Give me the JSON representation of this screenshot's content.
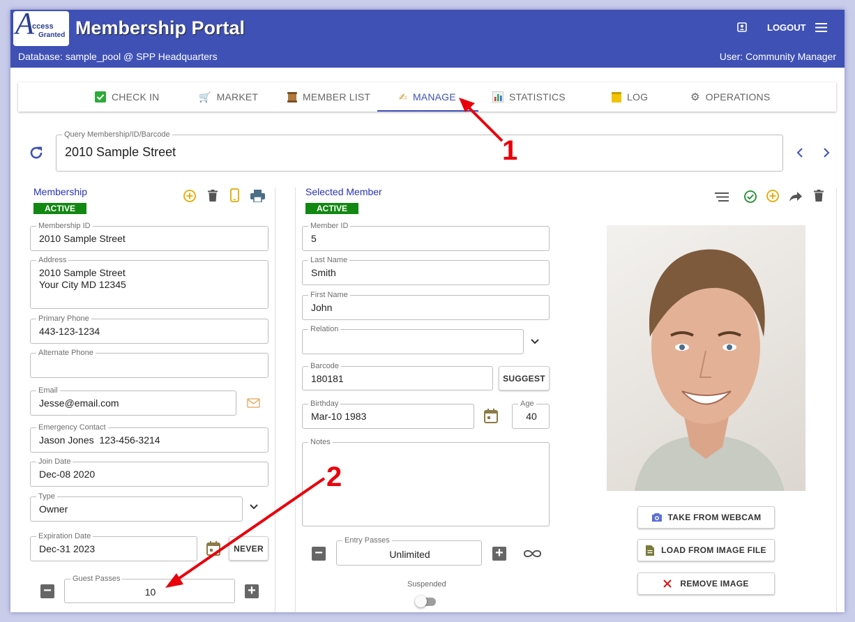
{
  "header": {
    "logo_line1": "ccess",
    "logo_line2": "Granted",
    "title": "Membership Portal",
    "database": "Database: sample_pool @ SPP Headquarters",
    "user": "User: Community Manager",
    "logout": "LOGOUT"
  },
  "tabs": [
    {
      "label": "CHECK IN",
      "icon": "check-mark-icon",
      "color": "#2eaa3a"
    },
    {
      "label": "MARKET",
      "icon": "cart-icon",
      "color": "#444"
    },
    {
      "label": "MEMBER LIST",
      "icon": "scroll-icon",
      "color": "#8b5a2b"
    },
    {
      "label": "MANAGE",
      "icon": "writing-hand-icon",
      "color": "#e0a030"
    },
    {
      "label": "STATISTICS",
      "icon": "bar-chart-icon",
      "color": "#d33"
    },
    {
      "label": "LOG",
      "icon": "notepad-icon",
      "color": "#e8c000"
    },
    {
      "label": "OPERATIONS",
      "icon": "gear-icon",
      "color": "#777"
    }
  ],
  "query": {
    "label": "Query Membership/ID/Barcode",
    "value": "2010 Sample Street"
  },
  "membership": {
    "title": "Membership",
    "status": "ACTIVE",
    "membership_id": {
      "label": "Membership ID",
      "value": "2010 Sample Street"
    },
    "address": {
      "label": "Address",
      "value": "2010 Sample Street\nYour City MD 12345"
    },
    "primary_phone": {
      "label": "Primary Phone",
      "value": "443-123-1234"
    },
    "alternate_phone": {
      "label": "Alternate Phone",
      "value": ""
    },
    "email": {
      "label": "Email",
      "value": "Jesse@email.com"
    },
    "emergency": {
      "label": "Emergency Contact",
      "value": "Jason Jones  123-456-3214"
    },
    "join_date": {
      "label": "Join Date",
      "value": "Dec-08 2020"
    },
    "type": {
      "label": "Type",
      "value": "Owner"
    },
    "expiration": {
      "label": "Expiration Date",
      "value": "Dec-31 2023"
    },
    "never": "NEVER",
    "guest_passes": {
      "label": "Guest Passes",
      "value": "10"
    }
  },
  "member": {
    "title": "Selected Member",
    "status": "ACTIVE",
    "member_id": {
      "label": "Member ID",
      "value": "5"
    },
    "last_name": {
      "label": "Last Name",
      "value": "Smith"
    },
    "first_name": {
      "label": "First Name",
      "value": "John"
    },
    "relation": {
      "label": "Relation",
      "value": ""
    },
    "barcode": {
      "label": "Barcode",
      "value": "180181"
    },
    "suggest": "SUGGEST",
    "birthday": {
      "label": "Birthday",
      "value": "Mar-10 1983"
    },
    "age": {
      "label": "Age",
      "value": "40"
    },
    "notes": {
      "label": "Notes",
      "value": ""
    },
    "entry_passes": {
      "label": "Entry Passes",
      "value": "Unlimited"
    },
    "suspended": "Suspended"
  },
  "photo": {
    "webcam": "TAKE FROM WEBCAM",
    "load": "LOAD FROM IMAGE FILE",
    "remove": "REMOVE IMAGE"
  },
  "annotations": {
    "one": "1",
    "two": "2"
  },
  "colors": {
    "header": "#3f51b5",
    "active_badge": "#118811",
    "annotation": "#e8000b",
    "add_icon": "#e6a800",
    "check_icon": "#1e8c2e"
  }
}
